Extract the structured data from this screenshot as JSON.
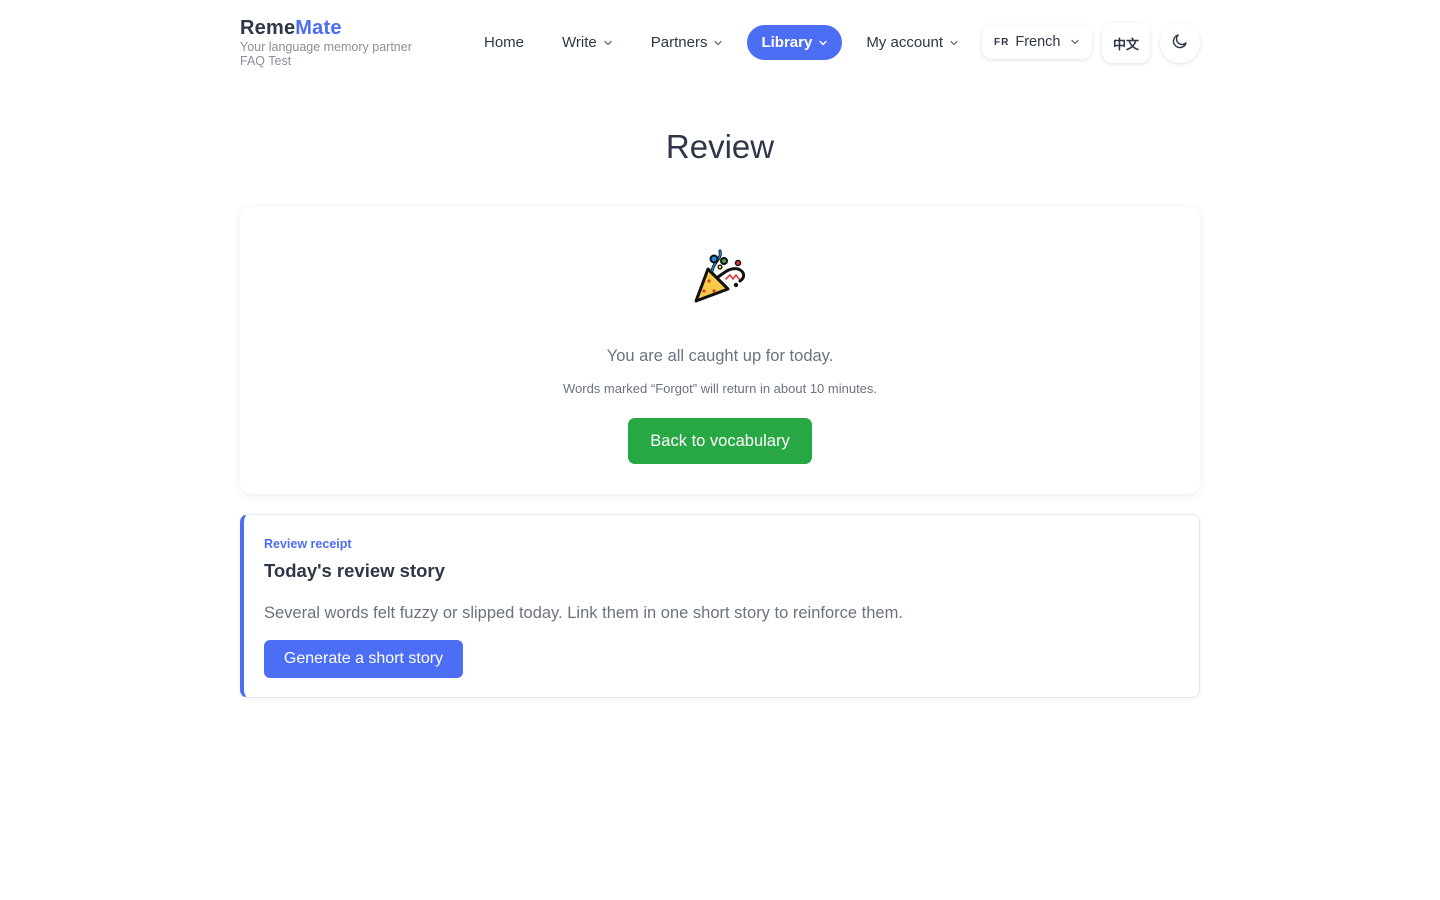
{
  "brand": {
    "name_part1": "Reme",
    "name_part2": "Mate",
    "tagline": "Your language memory partner",
    "user": "FAQ Test"
  },
  "nav": {
    "home": "Home",
    "write": "Write",
    "partners": "Partners",
    "library": "Library",
    "account": "My account"
  },
  "language": {
    "code": "FR",
    "name": "French"
  },
  "ui_language_label": "中文",
  "page_title": "Review",
  "main_card": {
    "message": "You are all caught up for today.",
    "note": "Words marked “Forgot” will return in about 10 minutes.",
    "button": "Back to vocabulary"
  },
  "receipt_card": {
    "tag": "Review receipt",
    "title": "Today's review story",
    "text": "Several words felt fuzzy or slipped today. Link them in one short story to reinforce them.",
    "button": "Generate a short story"
  },
  "colors": {
    "accent": "#4c6ef5",
    "success": "#28a745",
    "text": "#2d3748",
    "muted": "#6b7280"
  },
  "icons": [
    "chevron-down-icon",
    "moon-icon",
    "party-popper-icon"
  ]
}
